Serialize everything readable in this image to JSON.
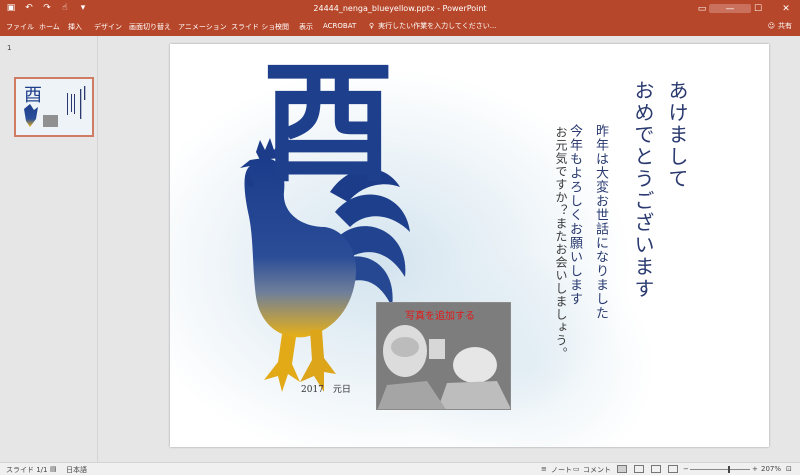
{
  "titlebar": {
    "document_title": "24444_nenga_blueyellow.pptx - PowerPoint",
    "icons": [
      "save-icon",
      "undo-icon",
      "redo-icon",
      "touch-mode-icon",
      "customize-qat-icon"
    ],
    "window_controls": [
      "ribbon-display-icon",
      "minimize-icon",
      "maximize-icon",
      "close-icon"
    ]
  },
  "ribbon": {
    "tabs": [
      "ファイル",
      "ホーム",
      "挿入",
      "デザイン",
      "画面切り替え",
      "アニメーション",
      "スライド ショー",
      "校閲",
      "表示",
      "ACROBAT"
    ],
    "tell_me": "実行したい作業を入力してください...",
    "share": "共有"
  },
  "thumbnail_pane": {
    "slide_number": "1"
  },
  "slide": {
    "greeting": [
      "あけまして",
      "おめでとうございます"
    ],
    "body": [
      "昨年は大変お世話になりました",
      "今年もよろしくお願いします"
    ],
    "closing": [
      "お元気ですか？またお会いしましょう。"
    ],
    "kanji": "酉",
    "photo_placeholder": "写真を追加する",
    "date": "2017　元日"
  },
  "statusbar": {
    "slide_info": "スライド 1/1",
    "language": "日本語",
    "notes": "ノート",
    "comments": "コメント",
    "zoom": "207%"
  },
  "colors": {
    "accent": "#b7472a",
    "ink": "#2a3a70",
    "bird_top": "#1e3f8c",
    "bird_bottom": "#e8b016",
    "photo_label": "#e21a1a"
  }
}
